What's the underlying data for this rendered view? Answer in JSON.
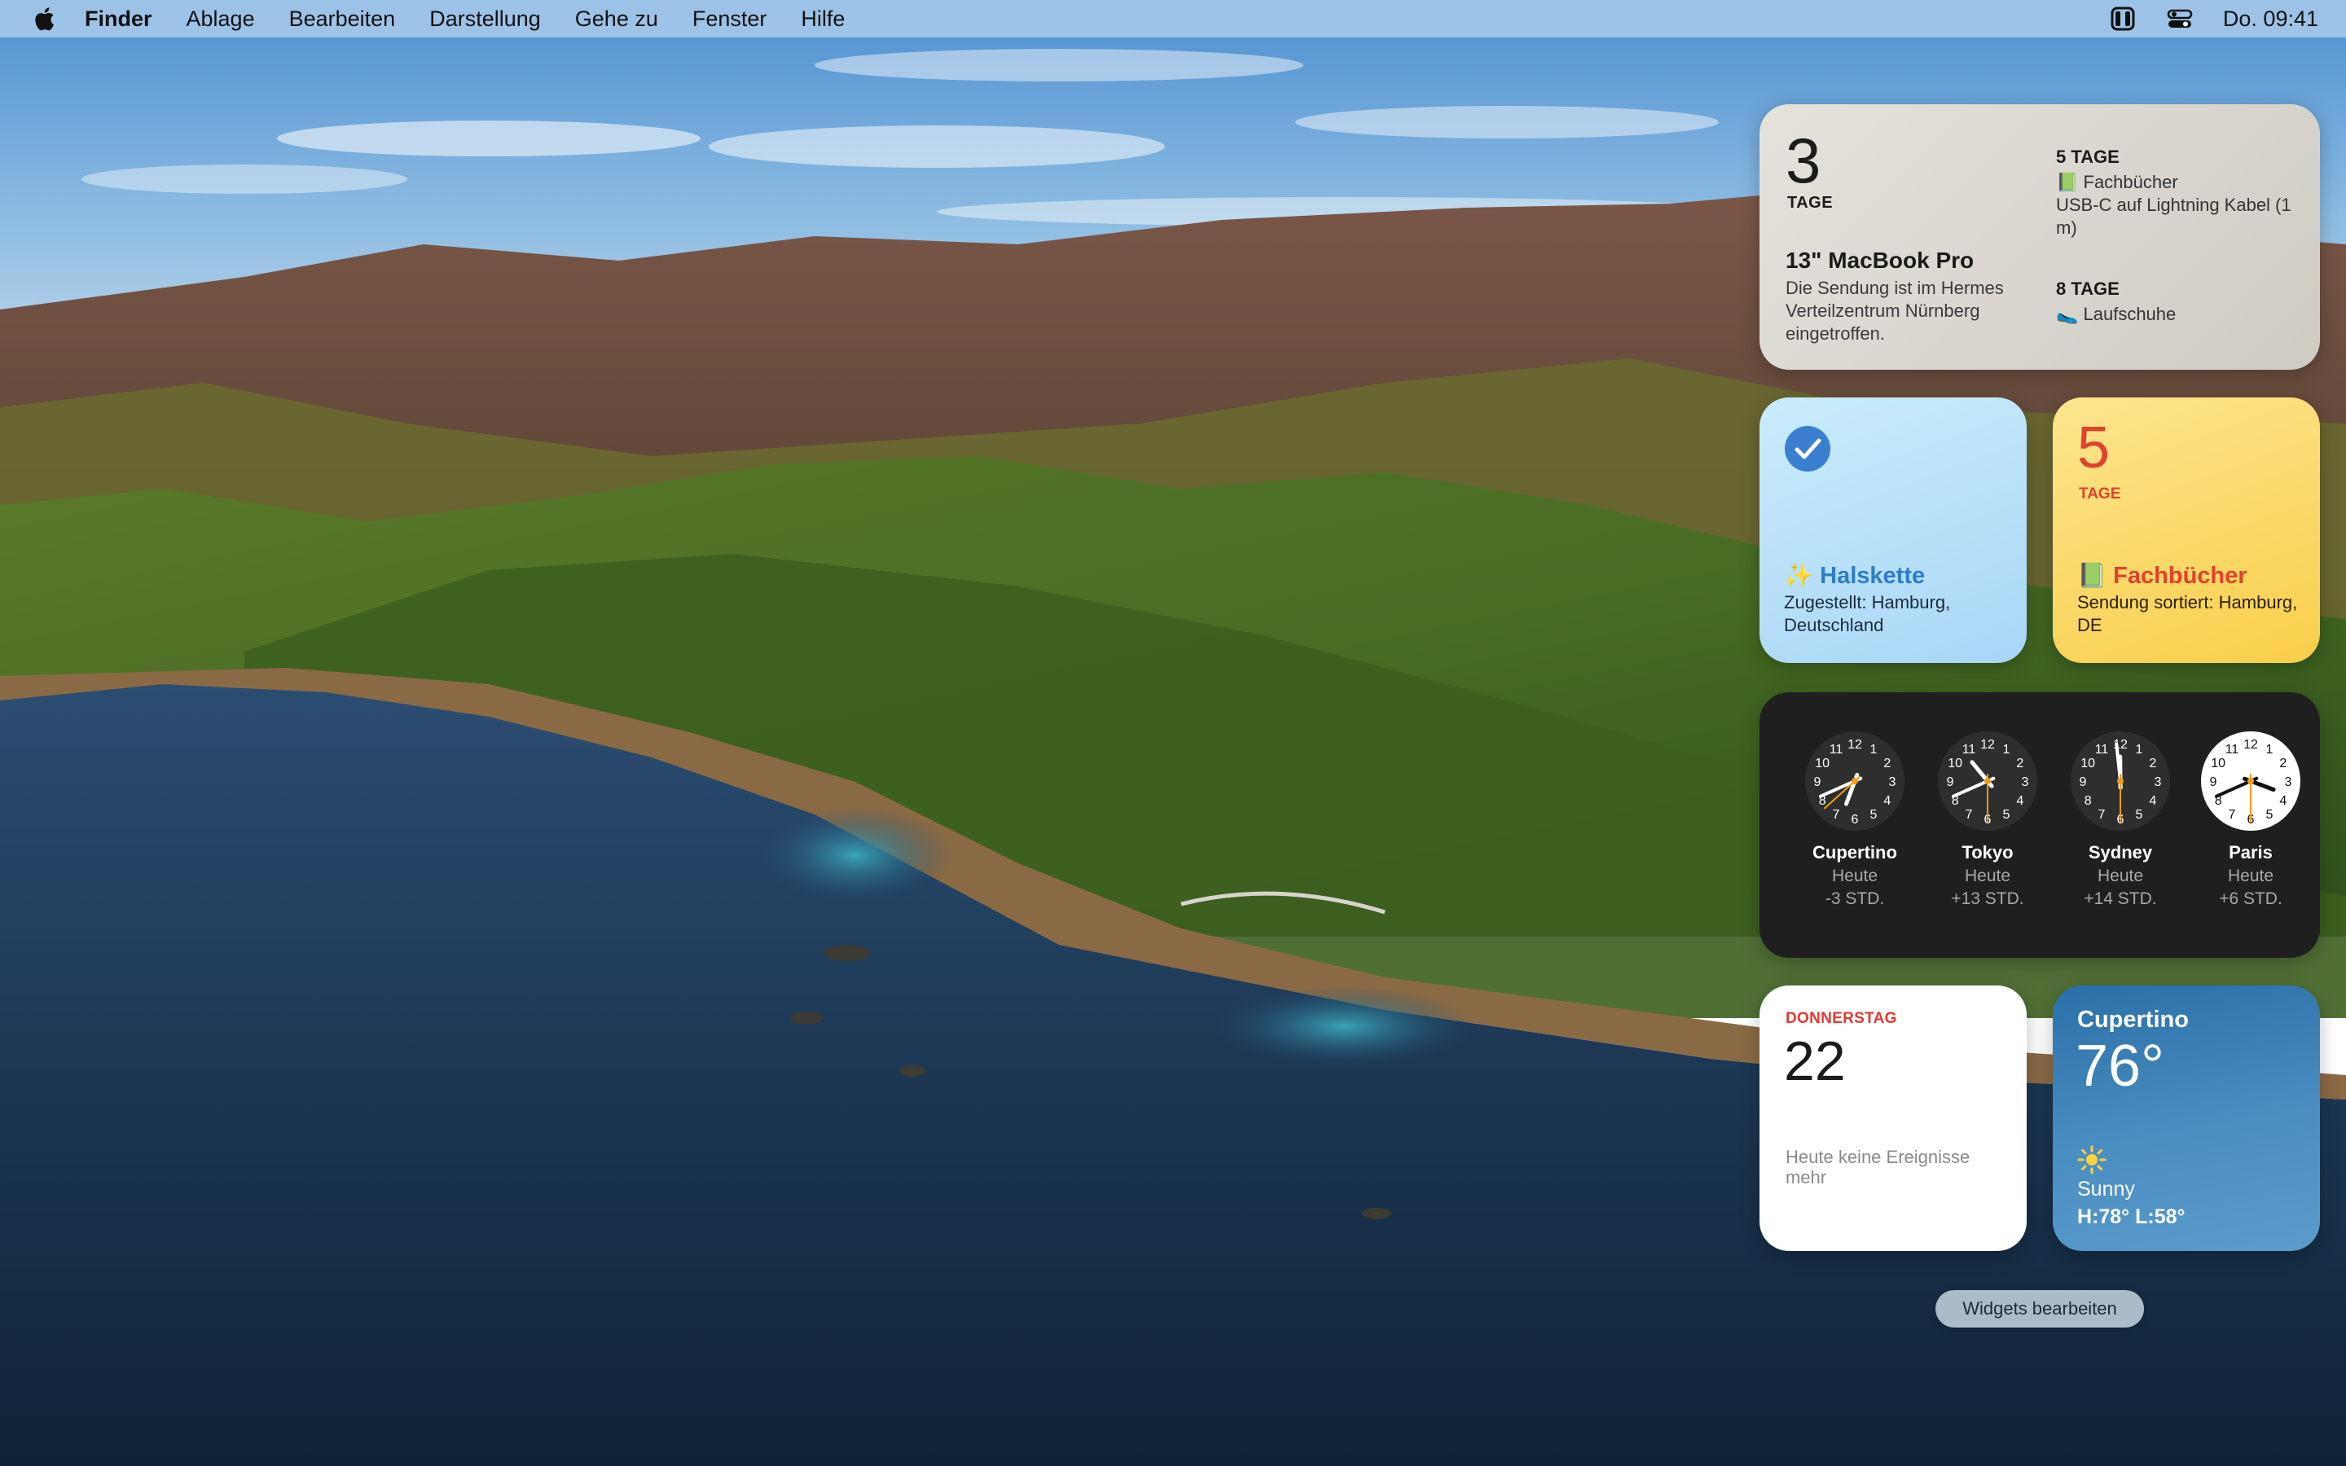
{
  "menubar": {
    "apple_icon": "apple-logo-icon",
    "app_name": "Finder",
    "menus": [
      "Ablage",
      "Bearbeiten",
      "Darstellung",
      "Gehe zu",
      "Fenster",
      "Hilfe"
    ],
    "status_icons": [
      "sidebar-icon",
      "control-center-icon"
    ],
    "clock": "Do. 09:41"
  },
  "parcel_large": {
    "days": "3",
    "days_label": "TAGE",
    "title": "13\" MacBook Pro",
    "description": "Die Sendung ist im Hermes Verteilzentrum Nürnberg eingetroffen.",
    "upcoming": [
      {
        "days": "5 TAGE",
        "item": "📗 Fachbücher",
        "detail": "USB-C auf Lightning Kabel (1 m)"
      },
      {
        "days": "8 TAGE",
        "item": "🥿 Laufschuhe",
        "detail": ""
      }
    ]
  },
  "parcel_blue": {
    "status_icon": "checkmark-circle-icon",
    "title": "✨ Halskette",
    "description": "Zugestellt: Hamburg, Deutschland"
  },
  "parcel_yellow": {
    "days": "5",
    "days_label": "TAGE",
    "title": "📗 Fachbücher",
    "description": "Sendung sortiert: Hamburg, DE"
  },
  "world_clock": {
    "clocks": [
      {
        "city": "Cupertino",
        "day": "Heute",
        "offset": "-3 STD.",
        "hour": 6,
        "minute": 41,
        "second": 38,
        "theme": "dark"
      },
      {
        "city": "Tokyo",
        "day": "Heute",
        "offset": "+13 STD.",
        "hour": 10,
        "minute": 41,
        "second": 30,
        "theme": "dark"
      },
      {
        "city": "Sydney",
        "day": "Heute",
        "offset": "+14 STD.",
        "hour": 11,
        "minute": 59,
        "second": 30,
        "theme": "dark"
      },
      {
        "city": "Paris",
        "day": "Heute",
        "offset": "+6 STD.",
        "hour": 3,
        "minute": 41,
        "second": 30,
        "theme": "light"
      }
    ],
    "colors": {
      "second_hand": "#f39c12"
    }
  },
  "calendar": {
    "weekday": "DONNERSTAG",
    "date": "22",
    "note": "Heute keine Ereignisse mehr"
  },
  "weather": {
    "city": "Cupertino",
    "temperature": "76°",
    "icon": "sun-icon",
    "condition": "Sunny",
    "high_low": "H:78° L:58°"
  },
  "edit_button": "Widgets bearbeiten"
}
